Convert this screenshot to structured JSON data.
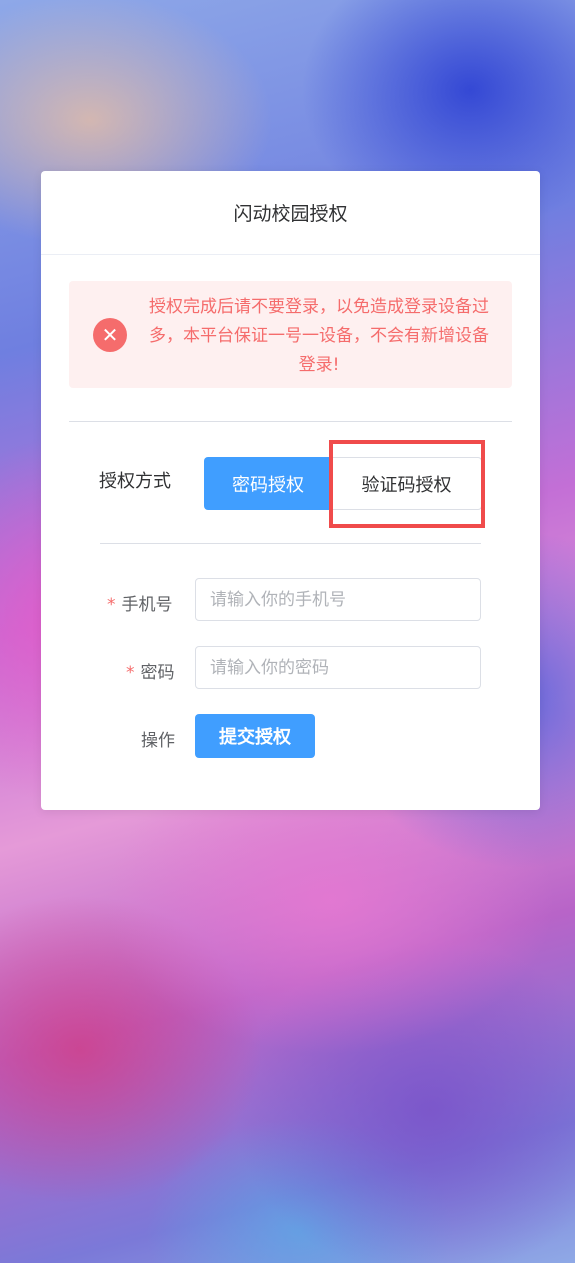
{
  "card": {
    "title": "闪动校园授权"
  },
  "alert": {
    "icon": "close-circle-icon",
    "message": "授权完成后请不要登录，以免造成登录设备过多，本平台保证一号一设备，不会有新增设备登录!"
  },
  "auth_method": {
    "label": "授权方式",
    "tabs": [
      {
        "label": "密码授权",
        "active": true
      },
      {
        "label": "验证码授权",
        "active": false
      }
    ]
  },
  "form": {
    "phone": {
      "required_mark": "*",
      "label": "手机号",
      "placeholder": "请输入你的手机号",
      "value": ""
    },
    "password": {
      "required_mark": "*",
      "label": "密码",
      "placeholder": "请输入你的密码",
      "value": ""
    },
    "action": {
      "label": "操作",
      "submit_label": "提交授权"
    }
  },
  "colors": {
    "primary": "#409eff",
    "error": "#f56c6c",
    "error_bg": "#fef0f0",
    "highlight": "#f04b4b"
  }
}
